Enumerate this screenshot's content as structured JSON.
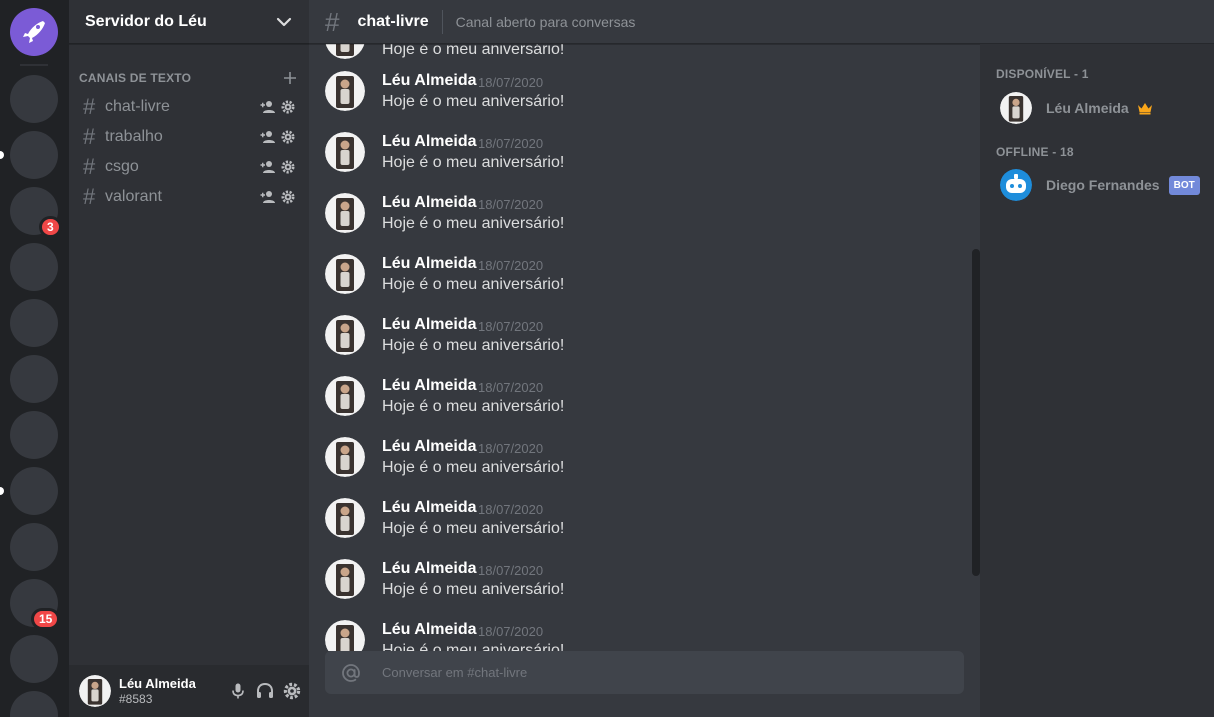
{
  "server_rail": {
    "badges": [
      "3",
      "15"
    ]
  },
  "guild": {
    "name": "Servidor do Léu"
  },
  "channels": {
    "category": "CANAIS DE TEXTO",
    "items": [
      {
        "name": "chat-livre"
      },
      {
        "name": "trabalho"
      },
      {
        "name": "csgo"
      },
      {
        "name": "valorant"
      }
    ]
  },
  "user_panel": {
    "name": "Léu Almeida",
    "tag": "#8583"
  },
  "chat": {
    "channel": "chat-livre",
    "topic": "Canal aberto para conversas",
    "partial_top_text": "Hoje é o meu aniversário!",
    "messages": [
      {
        "author": "Léu Almeida",
        "date": "18/07/2020",
        "text": "Hoje é o meu aniversário!"
      },
      {
        "author": "Léu Almeida",
        "date": "18/07/2020",
        "text": "Hoje é o meu aniversário!"
      },
      {
        "author": "Léu Almeida",
        "date": "18/07/2020",
        "text": "Hoje é o meu aniversário!"
      },
      {
        "author": "Léu Almeida",
        "date": "18/07/2020",
        "text": "Hoje é o meu aniversário!"
      },
      {
        "author": "Léu Almeida",
        "date": "18/07/2020",
        "text": "Hoje é o meu aniversário!"
      },
      {
        "author": "Léu Almeida",
        "date": "18/07/2020",
        "text": "Hoje é o meu aniversário!"
      },
      {
        "author": "Léu Almeida",
        "date": "18/07/2020",
        "text": "Hoje é o meu aniversário!"
      },
      {
        "author": "Léu Almeida",
        "date": "18/07/2020",
        "text": "Hoje é o meu aniversário!"
      },
      {
        "author": "Léu Almeida",
        "date": "18/07/2020",
        "text": "Hoje é o meu aniversário!"
      },
      {
        "author": "Léu Almeida",
        "date": "18/07/2020",
        "text": "Hoje é o meu aniversário!"
      }
    ],
    "composer_placeholder": "Conversar em #chat-livre"
  },
  "members": {
    "online_label": "DISPONÍVEL - 1",
    "online": [
      {
        "name": "Léu Almeida",
        "icon": "crown-icon"
      }
    ],
    "offline_label": "OFFLINE - 18",
    "offline": [
      {
        "name": "Diego Fernandes",
        "tag": "BOT"
      }
    ]
  },
  "colors": {
    "brand": "#7b5bd6",
    "bot_tag": "#7289da",
    "badge": "#f04747",
    "crown": "#faa61a"
  }
}
